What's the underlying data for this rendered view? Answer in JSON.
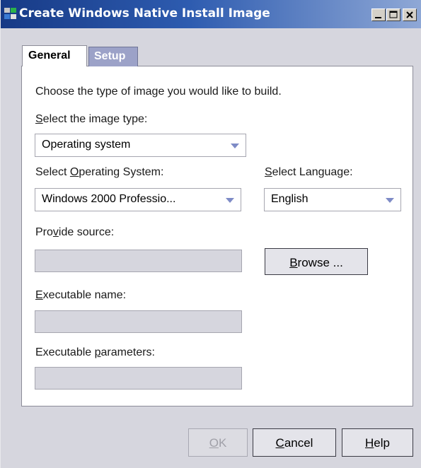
{
  "window": {
    "title": "Create Windows Native Install Image",
    "icon": "app-icon",
    "controls": [
      "minimize-icon",
      "maximize-icon",
      "close-icon"
    ]
  },
  "tabs": [
    {
      "label": "General",
      "active": true
    },
    {
      "label": "Setup",
      "active": false
    }
  ],
  "form": {
    "intro": "Choose the type of image you would like to build.",
    "image_type": {
      "label_pre": "",
      "label_key": "S",
      "label_post": "elect the image type:",
      "value": "Operating system"
    },
    "os": {
      "label_pre": "Select ",
      "label_key": "O",
      "label_post": "perating System:",
      "value": "Windows 2000 Professio..."
    },
    "language": {
      "label_pre": "",
      "label_key": "S",
      "label_post": "elect Language:",
      "value": "English"
    },
    "source": {
      "label_pre": "Pro",
      "label_key": "v",
      "label_post": "ide source:",
      "value": ""
    },
    "browse": {
      "label_pre": "",
      "label_key": "B",
      "label_post": "rowse ..."
    },
    "exe_name": {
      "label_pre": "",
      "label_key": "E",
      "label_post": "xecutable name:",
      "value": ""
    },
    "exe_params": {
      "label_pre": "Executable ",
      "label_key": "p",
      "label_post": "arameters:",
      "value": ""
    }
  },
  "buttons": {
    "ok": {
      "label_pre": "",
      "label_key": "O",
      "label_post": "K",
      "enabled": false
    },
    "cancel": {
      "label_pre": "",
      "label_key": "C",
      "label_post": "ancel",
      "enabled": true
    },
    "help": {
      "label_pre": "",
      "label_key": "H",
      "label_post": "elp",
      "enabled": true
    }
  },
  "colors": {
    "titlebar": "#173a86",
    "dialog_bg": "#d6d6de",
    "dropdown_arrow": "#7e8bc6",
    "inactive_tab": "#9ca2c8"
  }
}
